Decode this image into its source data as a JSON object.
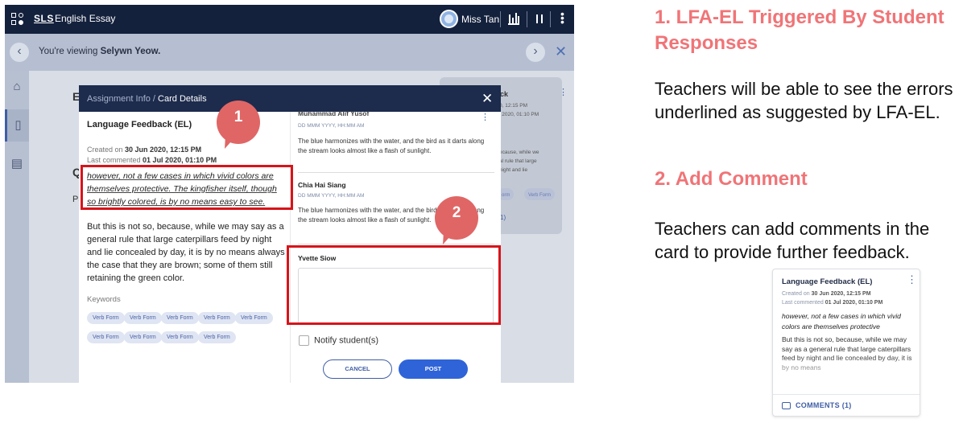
{
  "app": {
    "brand": "SLS",
    "title": "English Essay",
    "user": "Miss Tan"
  },
  "viewbar": {
    "prefix": "You're viewing ",
    "student": "Selywn Yeow."
  },
  "behind": {
    "heading_fragment": "Es",
    "q_fragment": "Q",
    "pa_fragment": "Pa",
    "card_title_fragment": "ack",
    "card_date1": "0, 12:15 PM",
    "card_date2": "l 2020, 01:10 PM",
    "card_lines": [
      "ecause, while we",
      "al rule that large",
      "night and lie"
    ],
    "card_chips": [
      "orm",
      "Verb Form"
    ],
    "card_comments": "1)"
  },
  "modal": {
    "breadcrumb_prefix": "Assignment Info / ",
    "breadcrumb_current": "Card Details",
    "card_title": "Language Feedback (EL)",
    "created_label": "Created on ",
    "created_value": "30 Jun 2020, 12:15 PM",
    "last_label": "Last commented ",
    "last_value": "01 Jul 2020, 01:10 PM",
    "quote": "however, not a few cases in which vivid colors are themselves protective. The kingfisher itself, though so brightly colored, is by no means easy to see.",
    "body": "But this is not so, because, while we may say as a general rule that large caterpillars feed by night and lie concealed by day, it is by no means always the case that they are brown; some of them still retaining the green color.",
    "keywords_label": "Keywords",
    "keywords": [
      "Verb Form",
      "Verb Form",
      "Verb Form",
      "Verb Form",
      "Verb Form",
      "Verb Form",
      "Verb Form",
      "Verb Form",
      "Verb Form"
    ],
    "comments": [
      {
        "name": "Muhammad Alif Yusof",
        "date": "DD MMM YYYY, HH:MM AM",
        "text": "The blue harmonizes with the water, and the bird as it darts along the stream looks almost like a flash of sunlight."
      },
      {
        "name": "Chia Hai Siang",
        "date": "DD MMM YYYY, HH:MM AM",
        "text": "The blue harmonizes with the water, and the bird as it darts along the stream looks almost like a flash of sunlight."
      }
    ],
    "reply_author": "Yvette Siow",
    "reply_value": "",
    "notify_label": "Notify student(s)",
    "cancel_label": "CANCEL",
    "post_label": "POST"
  },
  "callouts": {
    "one": "1",
    "two": "2",
    "color": "#e06666",
    "box_color": "#d7141a"
  },
  "explanation": {
    "heading1": "1. LFA-EL Triggered By Student Responses",
    "para1": "Teachers will be able to see the errors underlined as suggested by LFA-EL.",
    "heading2": "2. Add Comment",
    "para2": "Teachers can add comments in the card to provide further feedback.",
    "accent": "#f07477"
  },
  "mini_card": {
    "title": "Language Feedback (EL)",
    "created_label": "Created on ",
    "created_value": "30 Jun 2020, 12:15 PM",
    "last_label": "Last commented ",
    "last_value": "01 Jul 2020, 01:10 PM",
    "quote": "however, not a few cases in which vivid colors are themselves protective",
    "body": "But this is not so, because, while we may say as a general rule that large caterpillars feed by night and lie concealed by day, it is by no means",
    "comments_label": "COMMENTS (1)"
  }
}
